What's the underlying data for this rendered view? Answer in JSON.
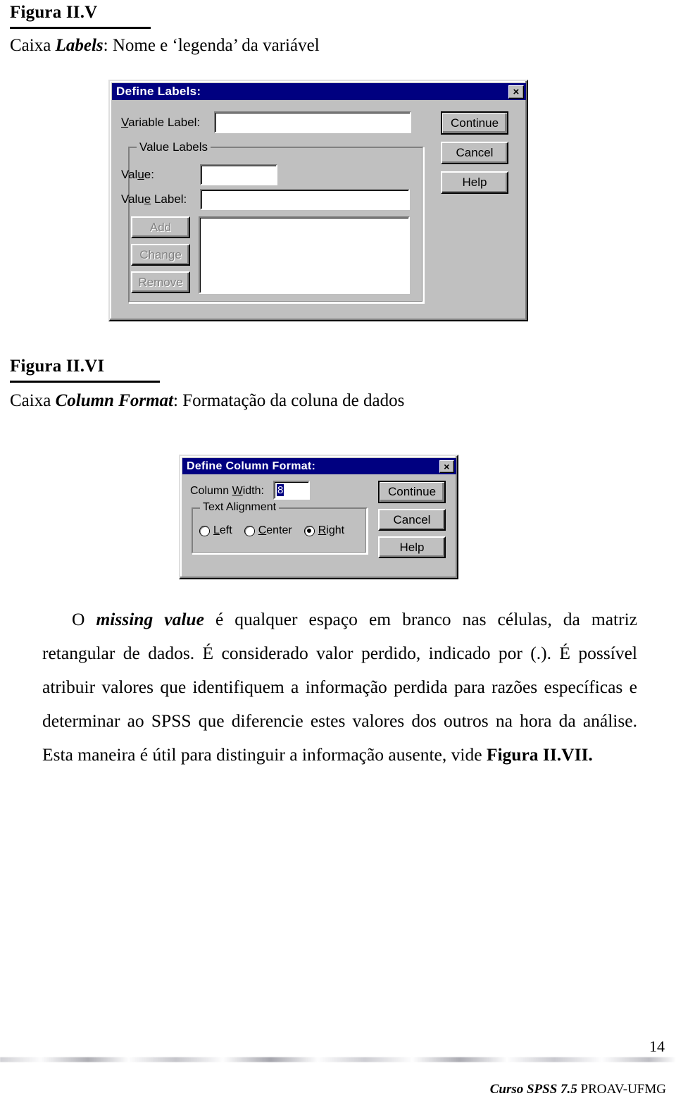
{
  "figure_v": {
    "title": "Figura II.V",
    "caption_prefix": "Caixa ",
    "caption_bold": "Labels",
    "caption_suffix": ": Nome e ‘legenda’ da variável"
  },
  "dialog_labels": {
    "title": "Define Labels:",
    "close_glyph": "×",
    "variable_label": "Variable Label:",
    "variable_label_value": "",
    "group_value_labels": "Value Labels",
    "value_label": "Value:",
    "value_value": "",
    "value_label_label": "Value Label:",
    "value_label_value": "",
    "list_items": [],
    "btn_add": "Add",
    "btn_change": "Change",
    "btn_remove": "Remove",
    "btn_continue": "Continue",
    "btn_cancel": "Cancel",
    "btn_help": "Help"
  },
  "figure_vi": {
    "title": "Figura II.VI",
    "caption_prefix": "Caixa ",
    "caption_bold": "Column Format",
    "caption_suffix": ": Formatação da coluna de dados"
  },
  "dialog_column_format": {
    "title": "Define Column Format:",
    "close_glyph": "×",
    "column_width_label": "Column Width:",
    "column_width_value": "8",
    "group_text_alignment": "Text Alignment",
    "radios": [
      {
        "label_pre": "",
        "accel": "L",
        "label_post": "eft",
        "selected": false
      },
      {
        "label_pre": "",
        "accel": "C",
        "label_post": "enter",
        "selected": false
      },
      {
        "label_pre": "",
        "accel": "R",
        "label_post": "ight",
        "selected": true
      }
    ],
    "selected_alignment": "Right",
    "btn_continue": "Continue",
    "btn_cancel": "Cancel",
    "btn_help": "Help"
  },
  "body": {
    "line1_pre": "O ",
    "line1_em": "missing value",
    "line1_post": " é qualquer espaço em branco nas células, da matriz retangular de dados. É considerado valor perdido, indicado por (.). É possível atribuir valores que identifiquem a informação perdida para razões específicas e determinar ao SPSS que diferencie estes valores dos outros na hora da análise. Esta maneira é útil para distinguir a informação ausente, vide ",
    "line1_ref": "Figura II.VII",
    "line1_end": "."
  },
  "footer": {
    "page_number": "14",
    "source_italic": "Curso SPSS 7.5",
    "source_regular": "PROAV-UFMG"
  },
  "colors": {
    "titlebar": "#000080",
    "dialog_face": "#c0c0c0",
    "field_bg": "#ffffff",
    "disabled_text": "#808080",
    "selection": "#000080"
  }
}
